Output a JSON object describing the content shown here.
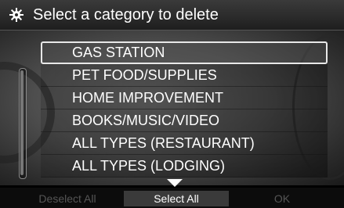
{
  "header": {
    "title": "Select a category to delete",
    "icon": "gear-icon"
  },
  "list": {
    "items": [
      {
        "label": "GAS STATION",
        "selected": true
      },
      {
        "label": "PET FOOD/SUPPLIES"
      },
      {
        "label": "HOME IMPROVEMENT"
      },
      {
        "label": "BOOKS/MUSIC/VIDEO"
      },
      {
        "label": "ALL TYPES (RESTAURANT)"
      },
      {
        "label": "ALL TYPES (LODGING)"
      }
    ]
  },
  "footer": {
    "deselect_all": "Deselect All",
    "select_all": "Select All",
    "ok": "OK"
  }
}
